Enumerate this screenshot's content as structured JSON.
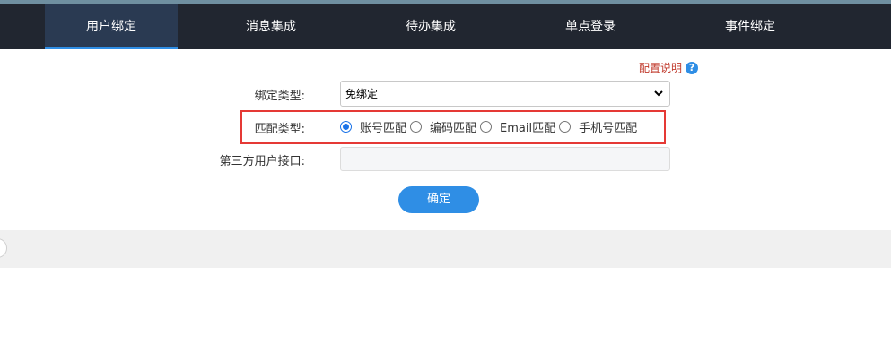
{
  "nav": {
    "tabs": [
      {
        "label": "用户绑定",
        "active": true
      },
      {
        "label": "消息集成",
        "active": false
      },
      {
        "label": "待办集成",
        "active": false
      },
      {
        "label": "单点登录",
        "active": false
      },
      {
        "label": "事件绑定",
        "active": false
      }
    ]
  },
  "help": {
    "label": "配置说明",
    "icon_glyph": "?"
  },
  "form": {
    "bind_type": {
      "label": "绑定类型:",
      "value": "免绑定"
    },
    "match_type": {
      "label": "匹配类型:",
      "options": [
        {
          "label": "账号匹配",
          "checked": true
        },
        {
          "label": "编码匹配",
          "checked": false
        },
        {
          "label": "Email匹配",
          "checked": false
        },
        {
          "label": "手机号匹配",
          "checked": false
        }
      ]
    },
    "third_party_api": {
      "label": "第三方用户接口:",
      "value": ""
    }
  },
  "confirm_label": "确定",
  "colors": {
    "nav_bg": "#212630",
    "accent": "#2f8ee5",
    "highlight": "#e53935",
    "help_text": "#c0392b"
  }
}
